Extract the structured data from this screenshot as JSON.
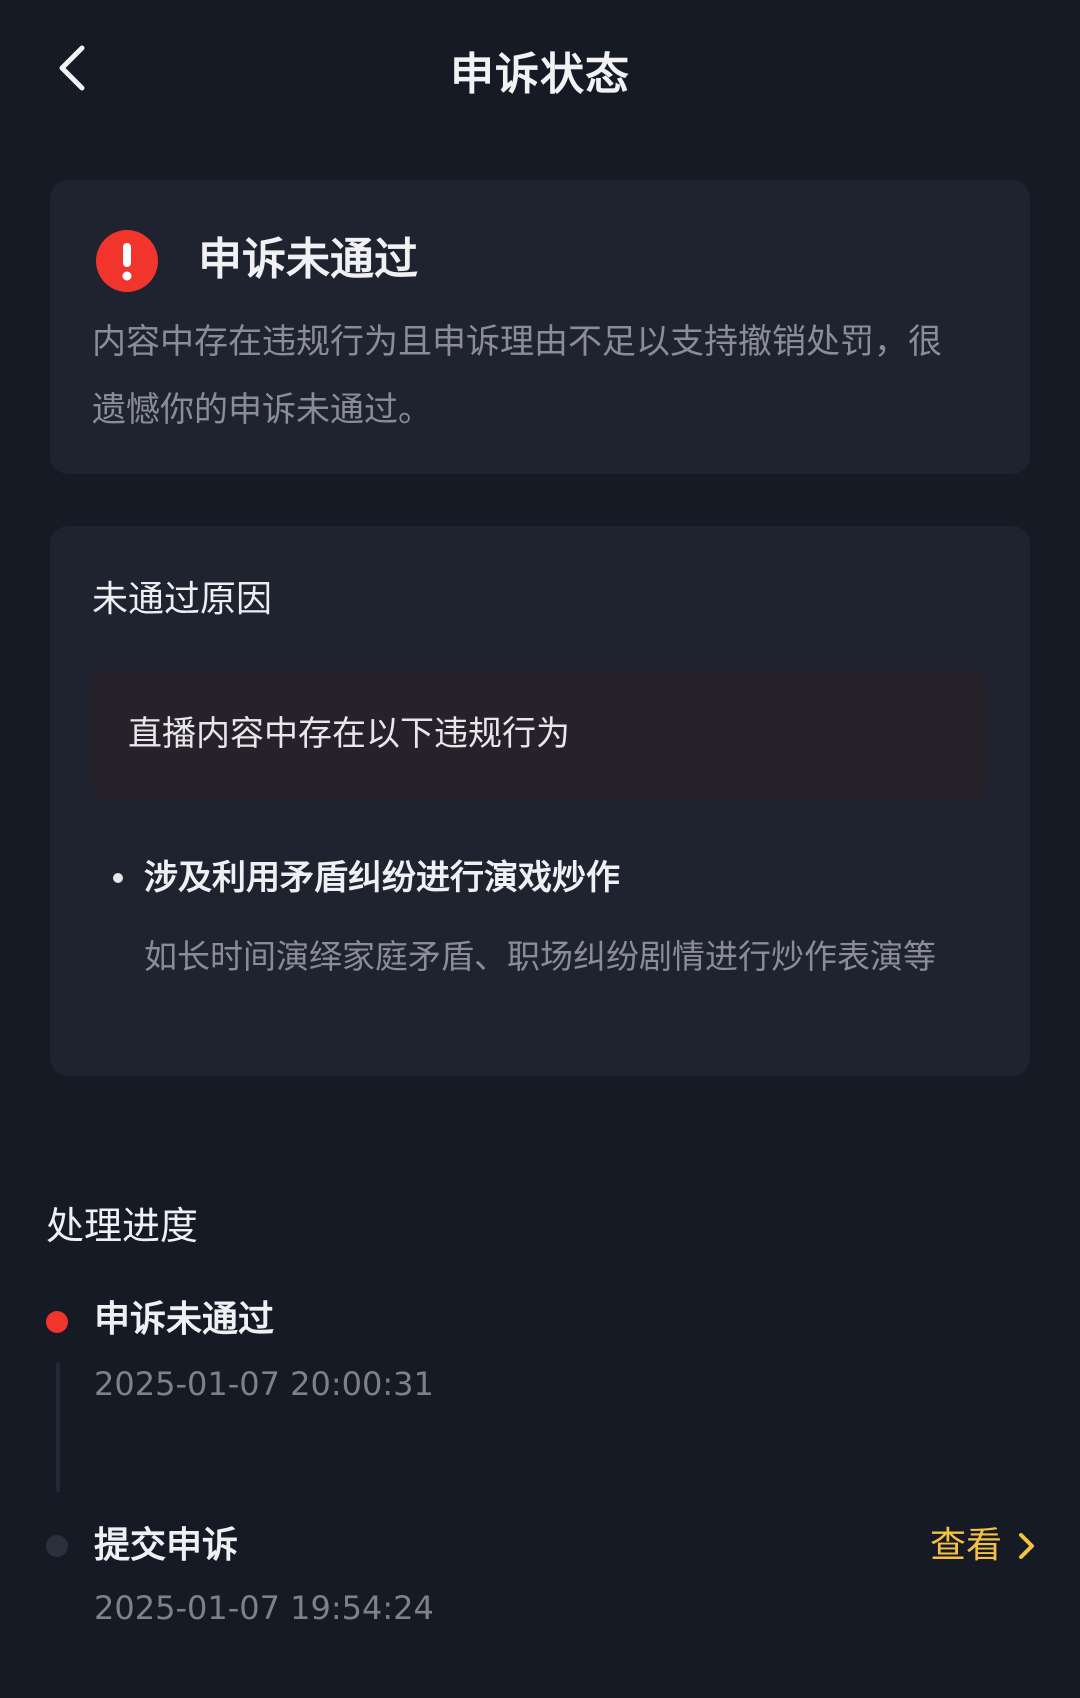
{
  "nav": {
    "title": "申诉状态"
  },
  "status_card": {
    "title": "申诉未通过",
    "description": "内容中存在违规行为且申诉理由不足以支持撤销处罚，很遗憾你的申诉未通过。",
    "icon": "alert-circle-icon",
    "icon_color": "#f2352c"
  },
  "reason_card": {
    "title": "未通过原因",
    "box_text": "直播内容中存在以下违规行为",
    "items": [
      {
        "title": "涉及利用矛盾纠纷进行演戏炒作",
        "description": "如长时间演绎家庭矛盾、职场纠纷剧情进行炒作表演等"
      }
    ]
  },
  "progress": {
    "title": "处理进度",
    "steps": [
      {
        "title": "申诉未通过",
        "time": "2025-01-07 20:00:31",
        "state": "active"
      },
      {
        "title": "提交申诉",
        "time": "2025-01-07 19:54:24",
        "state": "done",
        "action_label": "查看"
      }
    ]
  },
  "colors": {
    "background": "#161a25",
    "card": "#1f2330",
    "accent_red": "#f2352c",
    "link_yellow": "#f5c144"
  }
}
